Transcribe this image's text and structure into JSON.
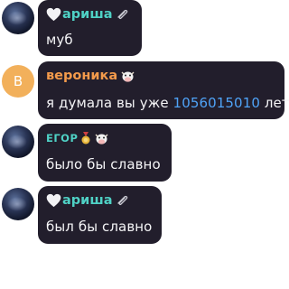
{
  "messages": [
    {
      "author": "ариша",
      "author_color": "#4fd1c5",
      "name_prefix_icon": "white-heart-icon",
      "badge_icons": [
        "paperclip-icon"
      ],
      "avatar": "photo",
      "text": "муб"
    },
    {
      "author": "вероника",
      "author_color": "#f39a4b",
      "badge_icons": [
        "cow-icon"
      ],
      "avatar": "letter",
      "avatar_letter": "В",
      "text_before": "я думала вы уже ",
      "text_number": "1056015010",
      "text_after": " лет"
    },
    {
      "author": "ЕГОР",
      "author_color": "#4fd1c5",
      "badge_icons": [
        "medal-icon",
        "cow-icon"
      ],
      "avatar": "photo",
      "text": "было бы славно"
    },
    {
      "author": "ариша",
      "author_color": "#4fd1c5",
      "name_prefix_icon": "white-heart-icon",
      "badge_icons": [
        "paperclip-icon"
      ],
      "avatar": "photo",
      "text": "был бы славно"
    }
  ]
}
